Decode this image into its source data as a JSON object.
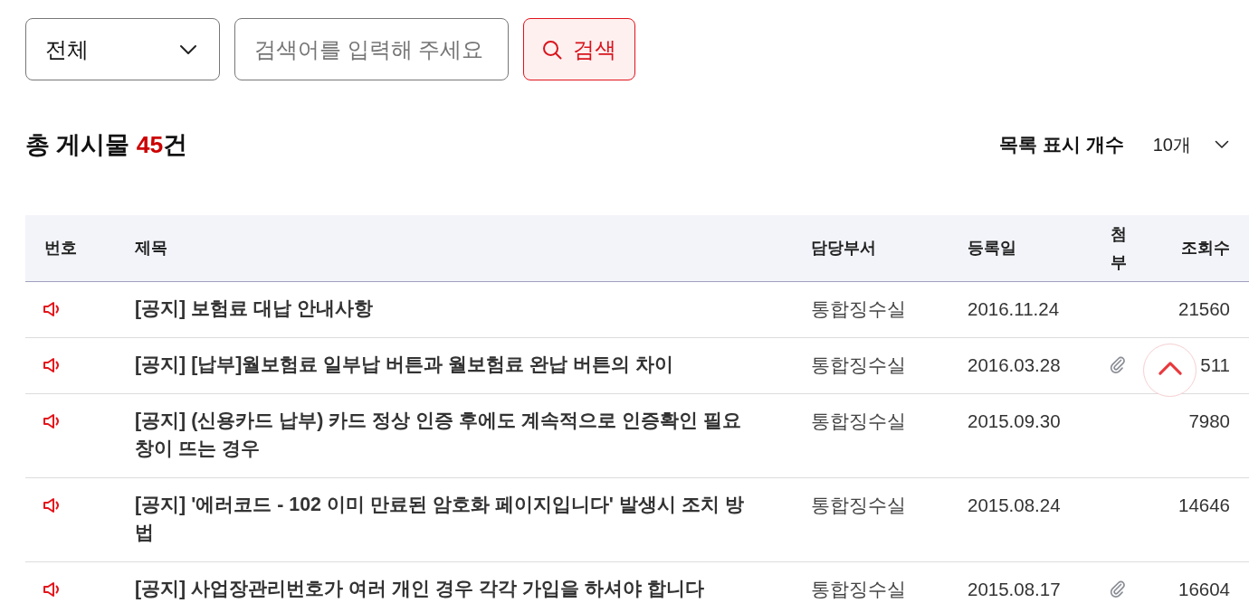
{
  "filter": {
    "category": {
      "value": "전체"
    },
    "search": {
      "placeholder": "검색어를 입력해 주세요"
    },
    "search_button": {
      "label": "검색"
    }
  },
  "summary": {
    "label": "총 게시물",
    "count": "45",
    "unit": "건"
  },
  "page_size": {
    "label": "목록 표시 개수",
    "value": "10개"
  },
  "table": {
    "columns": [
      "번호",
      "제목",
      "담당부서",
      "등록일",
      "첨부",
      "조회수"
    ],
    "rows": [
      {
        "kind": "notice",
        "title": "[공지] 보험료 대납 안내사항",
        "department": "통합징수실",
        "date": "2016.11.24",
        "attachment": false,
        "views": "21560"
      },
      {
        "kind": "notice",
        "title": "[공지] [납부]월보험료 일부납 버튼과 월보험료 완납 버튼의 차이",
        "department": "통합징수실",
        "date": "2016.03.28",
        "attachment": true,
        "views": "511"
      },
      {
        "kind": "notice",
        "title": "[공지] (신용카드 납부) 카드 정상 인증 후에도 계속적으로 인증확인 필요창이 뜨는 경우",
        "department": "통합징수실",
        "date": "2015.09.30",
        "attachment": false,
        "views": "7980"
      },
      {
        "kind": "notice",
        "title": "[공지] '에러코드 - 102 이미 만료된 암호화 페이지입니다' 발생시 조치 방법",
        "department": "통합징수실",
        "date": "2015.08.24",
        "attachment": false,
        "views": "14646"
      },
      {
        "kind": "notice",
        "title": "[공지] 사업장관리번호가 여러 개인 경우 각각 가입을 하셔야 합니다",
        "department": "통합징수실",
        "date": "2015.08.17",
        "attachment": true,
        "views": "16604"
      }
    ]
  }
}
